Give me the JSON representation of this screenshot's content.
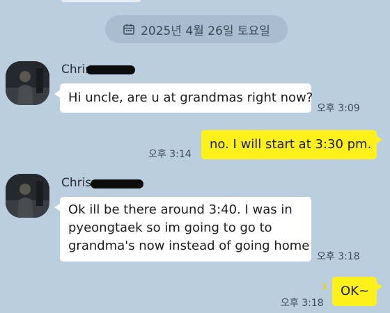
{
  "date_divider": {
    "icon": "calendar-icon",
    "text": "2025년 4월 26일 토요일"
  },
  "colors": {
    "background": "#bacee0",
    "incoming_bubble": "#ffffff",
    "outgoing_bubble": "#fef01b",
    "unread_count": "#e8d414"
  },
  "messages": [
    {
      "direction": "incoming",
      "sender": "Chris",
      "text": "Hi uncle, are u at grandmas right now?",
      "time": "오후 3:09"
    },
    {
      "direction": "outgoing",
      "text": "no.  I will start at 3:30 pm.",
      "time": "오후 3:14"
    },
    {
      "direction": "incoming",
      "sender": "Chris",
      "text_lines": [
        "Ok ill be there around 3:40. I was in",
        "pyeongtaek so im going to go to",
        "grandma's now instead of going home"
      ],
      "time": "오후 3:18"
    },
    {
      "direction": "outgoing",
      "text": "OK~",
      "time": "오후 3:18",
      "unread_count": "1"
    }
  ]
}
